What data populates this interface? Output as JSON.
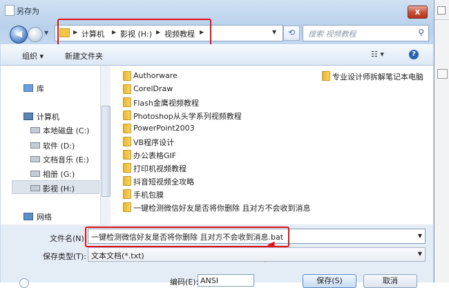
{
  "window": {
    "title": "另存为",
    "close_label": "x"
  },
  "nav": {
    "breadcrumbs": [
      "计算机",
      "影视 (H:)",
      "视频教程"
    ],
    "search_placeholder": "搜索 视频教程"
  },
  "toolbar": {
    "organize": "组织 ▾",
    "new_folder": "新建文件夹",
    "views": "☷ ▾",
    "help": "?"
  },
  "sidebar": {
    "items": [
      {
        "label": "库",
        "icon": "library-icon"
      },
      {
        "label": "计算机",
        "icon": "computer-icon"
      },
      {
        "label": "本地磁盘 (C:)",
        "icon": "drive-icon"
      },
      {
        "label": "软件 (D:)",
        "icon": "drive-icon"
      },
      {
        "label": "文档音乐 (E:)",
        "icon": "drive-icon"
      },
      {
        "label": "相册 (G:)",
        "icon": "drive-icon"
      },
      {
        "label": "影视 (H:)",
        "icon": "drive-icon",
        "selected": true
      },
      {
        "label": "网络",
        "icon": "network-icon"
      }
    ]
  },
  "files": {
    "left_column": [
      "Authorware",
      "CorelDraw",
      "Flash金鹰视频教程",
      "Photoshop从头学系列视频教程",
      "PowerPoint2003",
      "VB程序设计",
      "办公表格GIF",
      "打印机视频教程",
      "抖音短视频全攻略",
      "手机包膜",
      "一键检测微信好友是否将你删除 且对方不会收到消息"
    ],
    "right_column": [
      "专业设计师拆解笔记本电脑"
    ]
  },
  "form": {
    "filename_label": "文件名(N):",
    "filename_value": "一键检测微信好友是否将你删除 且对方不会收到消息.bat",
    "filetype_label": "保存类型(T):",
    "filetype_value": "文本文档(*.txt)",
    "encoding_label": "编码(E):",
    "encoding_value": "ANSI",
    "save_label": "保存(S)",
    "cancel_label": "取消"
  },
  "colors": {
    "annotation_red": "#e01010",
    "folder_yellow": "#f1c44a",
    "accent_blue": "#2c62b5"
  }
}
